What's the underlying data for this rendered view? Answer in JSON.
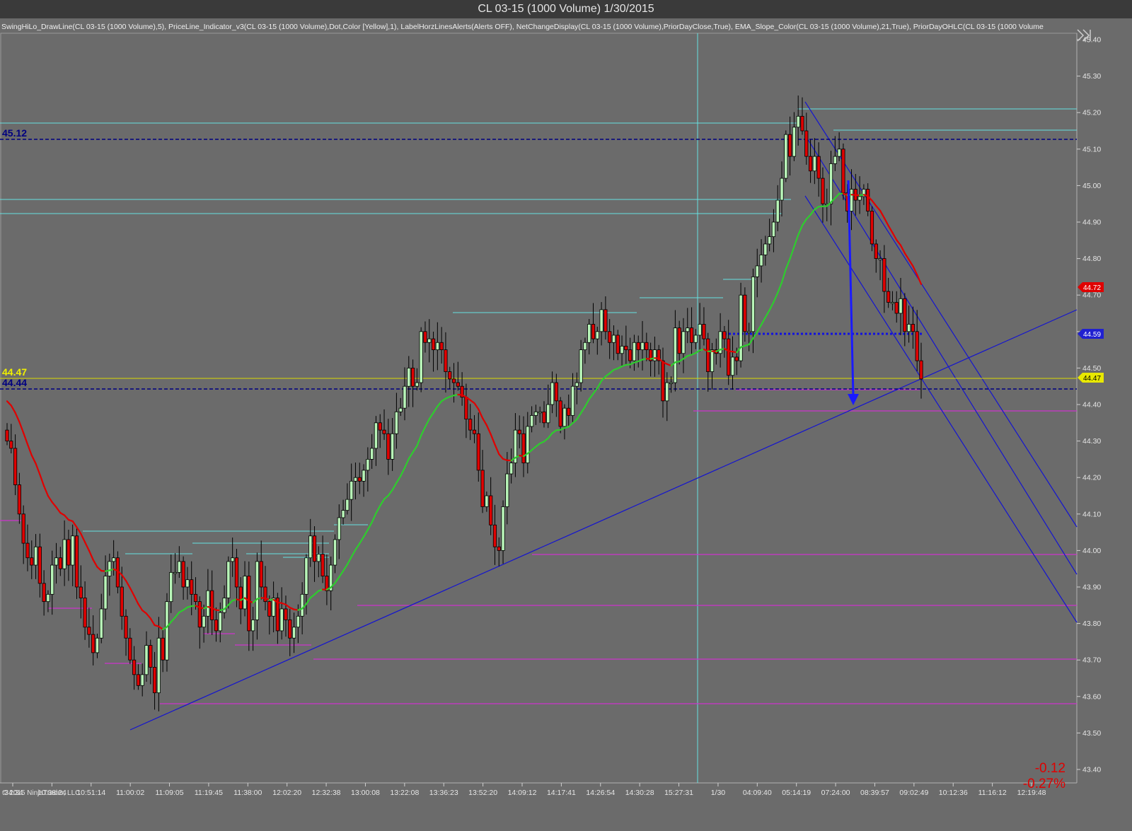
{
  "window": {
    "title": "CL 03-15 (1000 Volume)  1/30/2015"
  },
  "indicators_text": "SwingHiLo_DrawLine(CL 03-15 (1000 Volume),5), PriceLine_Indicator_v3(CL 03-15 (1000 Volume),Dot,Color [Yellow],1), LabelHorzLinesAlerts(Alerts OFF), NetChangeDisplay(CL 03-15 (1000 Volume),PriorDayClose,True), EMA_Slope_Color(CL 03-15 (1000 Volume),21,True), PriorDayOHLC(CL 03-15 (1000 Volume",
  "copyright": "© 2015 NinjaTrader, LLC",
  "net_change": {
    "points": "-0.12",
    "percent": "-0.27%"
  },
  "colors": {
    "background": "#6b6b6b",
    "up_candle": "#b8f5b8",
    "down_candle": "#e00000",
    "ema_up": "#2ecc2e",
    "ema_down": "#e00000",
    "swing_high": "#66e0e0",
    "swing_low": "#cc33cc",
    "trendline": "#1414d0",
    "dashed_level": "#000080",
    "price_line": "#e8e800"
  },
  "chart_data": {
    "type": "candlestick",
    "symbol": "CL 03-15",
    "bar_type": "1000 Volume",
    "y_range": [
      43.36,
      45.42
    ],
    "y_ticks": [
      "45.40",
      "45.30",
      "45.20",
      "45.10",
      "45.00",
      "44.90",
      "44.80",
      "44.70",
      "44.60",
      "44.50",
      "44.40",
      "44.30",
      "44.20",
      "44.10",
      "44.00",
      "43.90",
      "43.80",
      "43.70",
      "43.60",
      "43.50",
      "43.40"
    ],
    "x_ticks": [
      ":34:34",
      "10:38:24",
      "10:51:14",
      "11:00:02",
      "11:09:05",
      "11:19:45",
      "11:38:00",
      "12:02:20",
      "12:32:38",
      "13:00:08",
      "13:22:08",
      "13:36:23",
      "13:52:20",
      "14:09:12",
      "14:17:41",
      "14:26:54",
      "14:30:28",
      "15:27:31",
      "1/30",
      "04:09:40",
      "05:14:19",
      "07:24:00",
      "08:39:57",
      "09:02:49",
      "10:12:36",
      "11:16:12",
      "12:19:48"
    ],
    "closes": [
      44.3,
      44.28,
      44.18,
      44.1,
      44.02,
      43.98,
      43.96,
      44.01,
      43.91,
      43.86,
      43.88,
      43.96,
      43.98,
      43.95,
      44.03,
      43.96,
      44.04,
      43.9,
      43.87,
      43.79,
      43.77,
      43.72,
      43.76,
      43.84,
      43.93,
      43.97,
      43.98,
      43.9,
      43.82,
      43.76,
      43.7,
      43.66,
      43.63,
      43.66,
      43.74,
      43.68,
      43.61,
      43.76,
      43.7,
      43.86,
      43.94,
      43.94,
      43.97,
      43.9,
      43.92,
      43.88,
      43.86,
      43.79,
      43.82,
      43.89,
      43.81,
      43.78,
      43.83,
      43.87,
      43.97,
      43.98,
      43.9,
      43.84,
      43.93,
      43.78,
      43.81,
      43.97,
      43.9,
      43.86,
      43.82,
      43.87,
      43.78,
      43.84,
      43.81,
      43.76,
      43.79,
      43.82,
      43.88,
      43.98,
      44.04,
      43.97,
      43.99,
      43.93,
      43.89,
      43.96,
      44.03,
      44.09,
      44.11,
      44.14,
      44.19,
      44.2,
      44.19,
      44.22,
      44.25,
      44.28,
      44.35,
      44.33,
      44.32,
      44.25,
      44.32,
      44.38,
      44.39,
      44.45,
      44.5,
      44.45,
      44.46,
      44.6,
      44.57,
      44.58,
      44.55,
      44.57,
      44.55,
      44.49,
      44.47,
      44.46,
      44.45,
      44.42,
      44.36,
      44.33,
      44.32,
      44.22,
      44.12,
      44.15,
      44.07,
      44.01,
      44.0,
      44.12,
      44.21,
      44.24,
      44.33,
      44.32,
      44.24,
      44.34,
      44.37,
      44.38,
      44.38,
      44.35,
      44.4,
      44.46,
      44.41,
      44.34,
      44.39,
      44.37,
      44.45,
      44.46,
      44.55,
      44.57,
      44.62,
      44.58,
      44.6,
      44.66,
      44.6,
      44.57,
      44.59,
      44.54,
      44.56,
      44.55,
      44.52,
      44.57,
      44.55,
      44.57,
      44.55,
      44.52,
      44.55,
      44.52,
      44.41,
      44.46,
      44.46,
      44.61,
      44.54,
      44.6,
      44.61,
      44.57,
      44.59,
      44.62,
      44.58,
      44.49,
      44.55,
      44.54,
      44.6,
      44.58,
      44.48,
      44.53,
      44.52,
      44.7,
      44.6,
      44.6,
      44.75,
      44.78,
      44.81,
      44.84,
      44.86,
      44.9,
      44.96,
      45.02,
      45.14,
      45.08,
      45.16,
      45.19,
      45.15,
      45.08,
      45.04,
      45.08,
      45.02,
      44.95,
      44.95,
      45.06,
      45.08,
      45.1,
      44.98,
      44.93,
      44.99,
      44.96,
      44.97,
      44.99,
      44.93,
      44.84,
      44.8,
      44.8,
      44.71,
      44.68,
      44.68,
      44.65,
      44.69,
      44.6,
      44.62,
      44.6,
      44.52,
      44.47
    ]
  }
}
